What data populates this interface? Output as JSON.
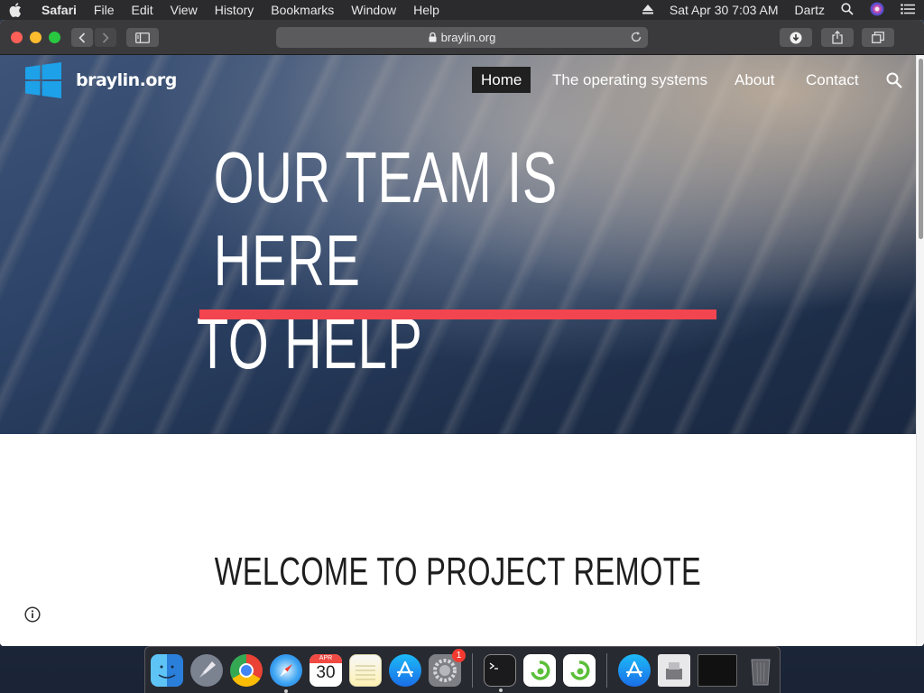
{
  "menubar": {
    "app": "Safari",
    "items": [
      "File",
      "Edit",
      "View",
      "History",
      "Bookmarks",
      "Window",
      "Help"
    ],
    "clock": "Sat Apr 30  7:03 AM",
    "user": "Dartz"
  },
  "browser": {
    "url": "braylin.org"
  },
  "site": {
    "brand": "braylin.org",
    "nav": [
      "Home",
      "The operating systems",
      "About",
      "Contact"
    ],
    "active_nav": "Home",
    "hero_line1": "OUR TEAM IS HERE",
    "hero_line2": "TO HELP",
    "welcome": "WELCOME TO PROJECT REMOTE",
    "accent_color": "#f2454f",
    "logo_color": "#1da1e8"
  },
  "dock": {
    "calendar_month": "APR",
    "calendar_day": "30",
    "badge": "1",
    "apps": [
      "finder-icon",
      "launchpad-icon",
      "chrome-icon",
      "safari-icon",
      "calendar-icon",
      "notes-icon",
      "app-store-icon",
      "system-preferences-icon",
      "terminal-icon",
      "dict-app-icon",
      "dict-app-2-icon",
      "app-store-download-icon",
      "disk-icon",
      "window-icon",
      "trash-icon"
    ]
  }
}
